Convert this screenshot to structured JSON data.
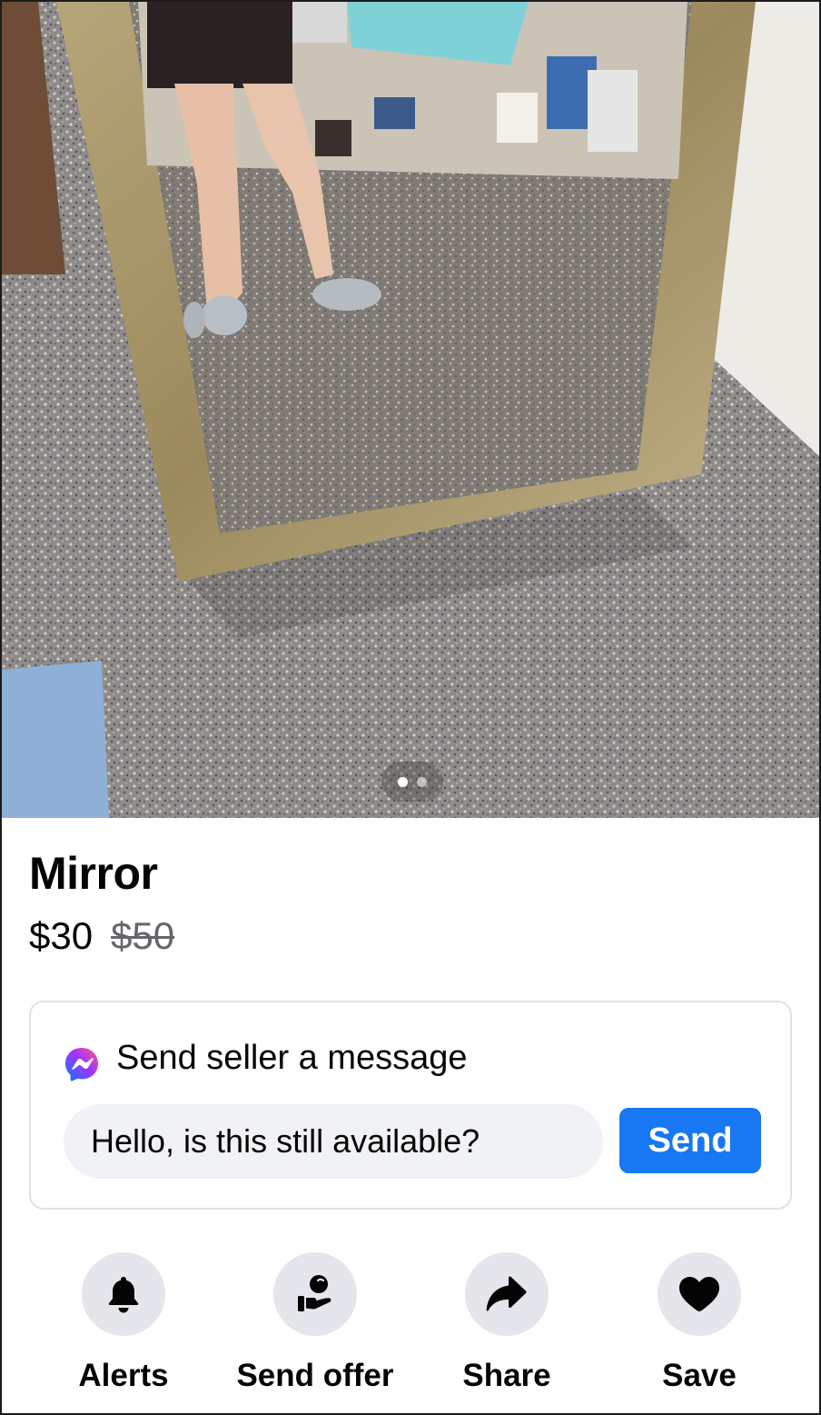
{
  "listing": {
    "title": "Mirror",
    "price": "$30",
    "original_price": "$50"
  },
  "photo": {
    "subject": "mirror-photo",
    "carousel_total": 2,
    "carousel_active": 1
  },
  "message": {
    "header": "Send seller a message",
    "input_value": "Hello, is this still available?",
    "send_label": "Send",
    "icon": "messenger-icon"
  },
  "actions": [
    {
      "label": "Alerts",
      "icon": "bell-icon"
    },
    {
      "label": "Send offer",
      "icon": "offer-icon"
    },
    {
      "label": "Share",
      "icon": "share-icon"
    },
    {
      "label": "Save",
      "icon": "heart-icon"
    }
  ],
  "colors": {
    "accent": "#1877f2",
    "button_bg": "#e4e6eb",
    "input_bg": "#f0f2f5",
    "muted_text": "#65676b"
  }
}
